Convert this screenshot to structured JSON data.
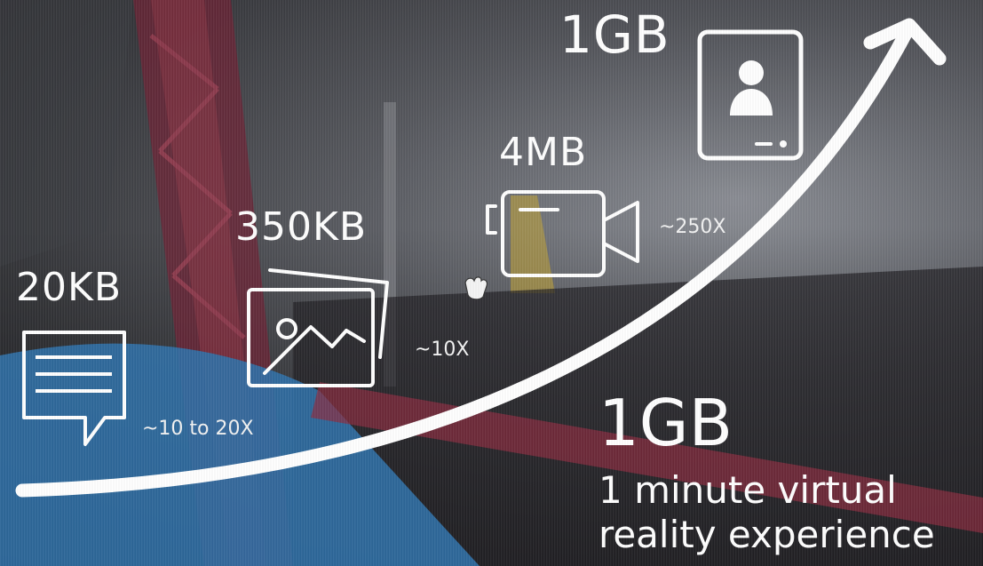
{
  "steps": [
    {
      "size": "20KB",
      "multiplier": "~10 to 20X",
      "icon": "message-icon"
    },
    {
      "size": "350KB",
      "multiplier": "~10X",
      "icon": "photo-icon"
    },
    {
      "size": "4MB",
      "multiplier": "~250X",
      "icon": "video-camera-icon"
    },
    {
      "size": "1GB",
      "multiplier": "",
      "icon": "tablet-user-icon"
    }
  ],
  "highlight": {
    "value": "1GB",
    "line1": "1 minute virtual",
    "line2": "reality experience"
  },
  "colors": {
    "foreground": "#ffffff",
    "sky": "#8c8f96",
    "rail": "#8a2b3e",
    "water": "#2f6fa6"
  }
}
